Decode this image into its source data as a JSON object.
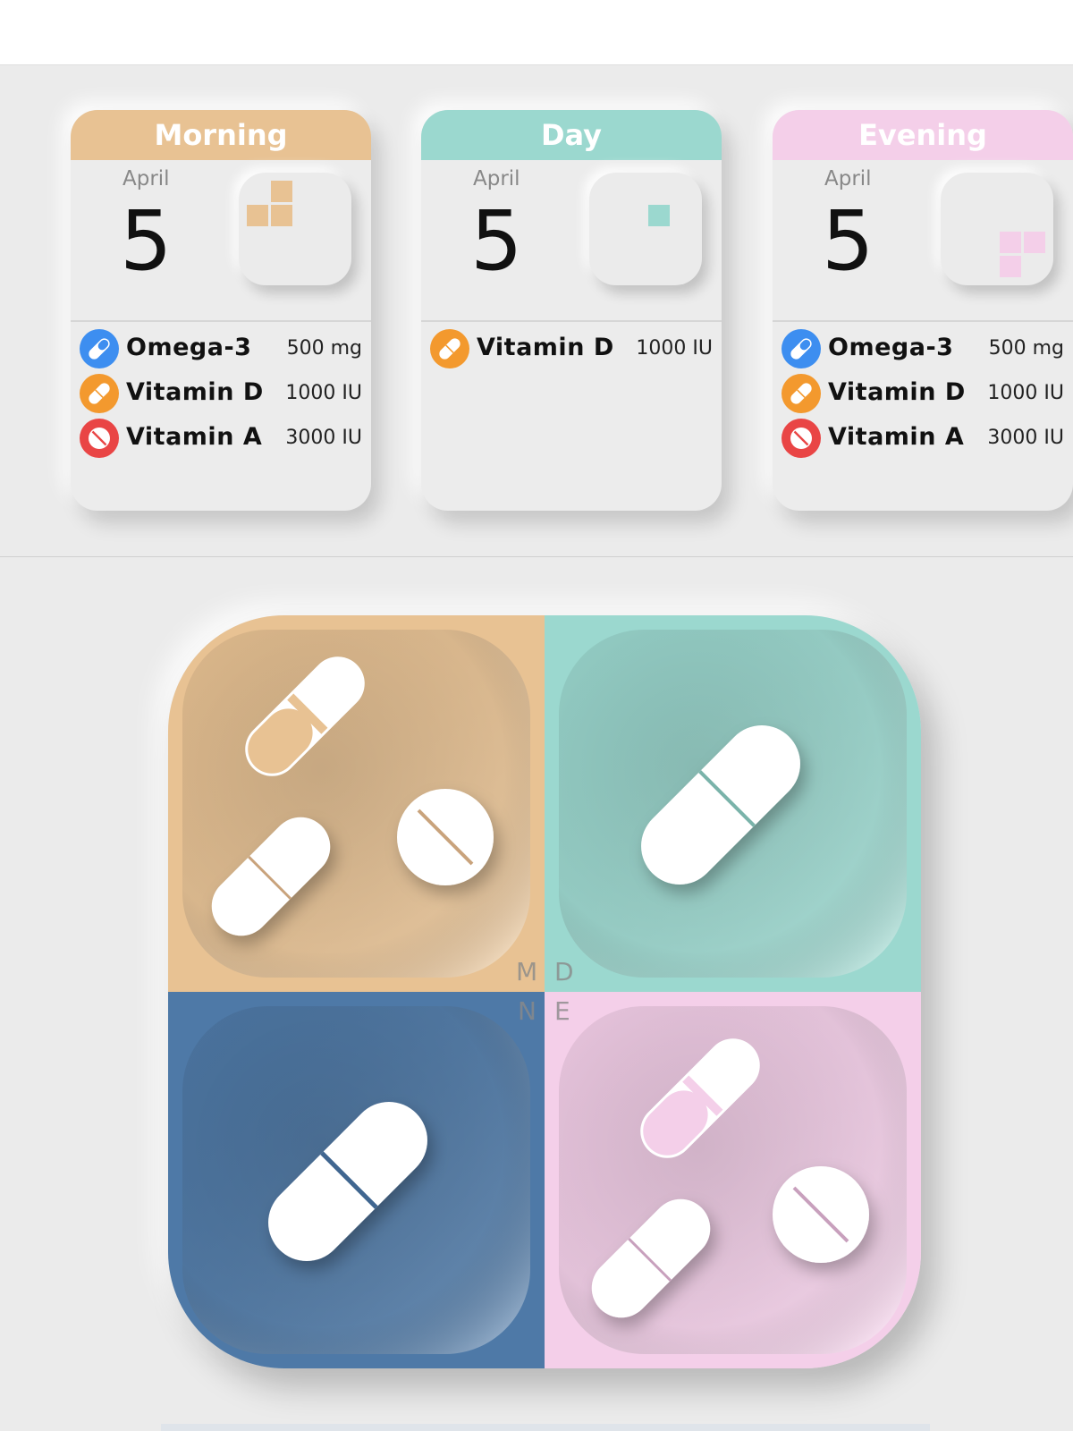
{
  "colors": {
    "morning": "#e8c293",
    "day": "#9bd8cf",
    "evening": "#f4cfe9",
    "night": "#4e79a7"
  },
  "widgets": [
    {
      "title": "Morning",
      "month": "April",
      "day": "5",
      "items": [
        {
          "name": "Omega-3",
          "dose": "500 mg",
          "icon": "capsule-blue-icon"
        },
        {
          "name": "Vitamin D",
          "dose": "1000 IU",
          "icon": "capsule-orange-icon"
        },
        {
          "name": "Vitamin A",
          "dose": "3000 IU",
          "icon": "tablet-red-icon"
        }
      ]
    },
    {
      "title": "Day",
      "month": "April",
      "day": "5",
      "items": [
        {
          "name": "Vitamin D",
          "dose": "1000 IU",
          "icon": "capsule-orange-icon"
        }
      ]
    },
    {
      "title": "Evening",
      "month": "April",
      "day": "5",
      "items": [
        {
          "name": "Omega-3",
          "dose": "500 mg",
          "icon": "capsule-blue-icon"
        },
        {
          "name": "Vitamin D",
          "dose": "1000 IU",
          "icon": "capsule-orange-icon"
        },
        {
          "name": "Vitamin A",
          "dose": "3000 IU",
          "icon": "tablet-red-icon"
        }
      ]
    }
  ],
  "tray": {
    "labels": {
      "morning": "M",
      "day": "D",
      "night": "N",
      "evening": "E"
    }
  }
}
